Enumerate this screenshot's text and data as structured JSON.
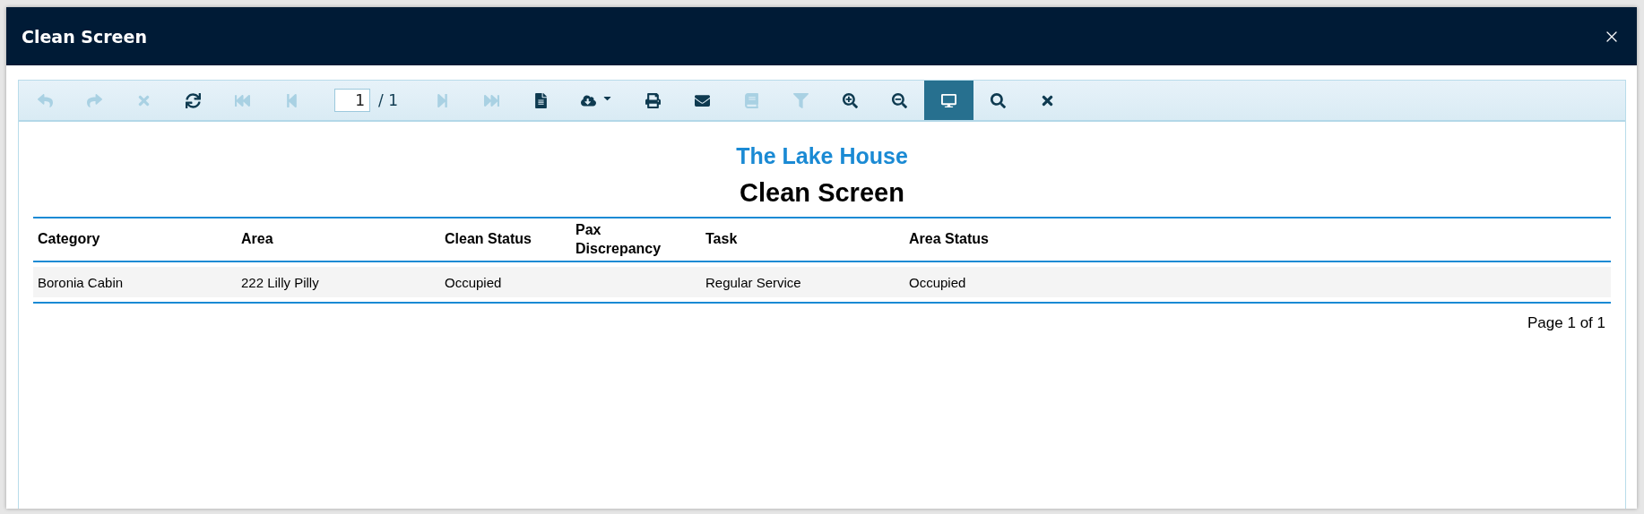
{
  "window": {
    "title": "Clean Screen"
  },
  "toolbar": {
    "left_buttons": [
      {
        "disabled": true,
        "selected": false
      },
      {
        "disabled": true,
        "selected": false
      },
      {
        "disabled": true,
        "selected": false
      },
      {
        "disabled": false,
        "selected": false
      },
      {
        "disabled": true,
        "selected": false
      },
      {
        "disabled": true,
        "selected": false
      }
    ],
    "page": {
      "value": "1",
      "total": "/ 1"
    },
    "right_buttons": [
      {
        "disabled": true,
        "selected": false,
        "has_menu": false
      },
      {
        "disabled": true,
        "selected": false,
        "has_menu": false
      },
      {
        "disabled": false,
        "selected": false,
        "has_menu": false
      },
      {
        "disabled": false,
        "selected": false,
        "has_menu": true
      },
      {
        "disabled": false,
        "selected": false,
        "has_menu": false
      },
      {
        "disabled": false,
        "selected": false,
        "has_menu": false
      },
      {
        "disabled": true,
        "selected": false,
        "has_menu": false
      },
      {
        "disabled": true,
        "selected": false,
        "has_menu": false
      },
      {
        "disabled": false,
        "selected": false,
        "has_menu": false
      },
      {
        "disabled": false,
        "selected": false,
        "has_menu": false
      },
      {
        "disabled": false,
        "selected": true,
        "has_menu": false
      },
      {
        "disabled": false,
        "selected": false,
        "has_menu": false
      },
      {
        "disabled": false,
        "selected": false,
        "has_menu": false
      }
    ]
  },
  "report": {
    "company": "The Lake House",
    "title": "Clean Screen",
    "table": {
      "columns": [
        "Category",
        "Area",
        "Clean Status",
        "Pax Discrepancy",
        "Task",
        "Area Status"
      ],
      "rows": [
        [
          "Boronia Cabin",
          "222 Lilly Pilly",
          "Occupied",
          "",
          "Regular Service",
          "Occupied"
        ]
      ]
    },
    "footer": "Page 1 of 1"
  }
}
